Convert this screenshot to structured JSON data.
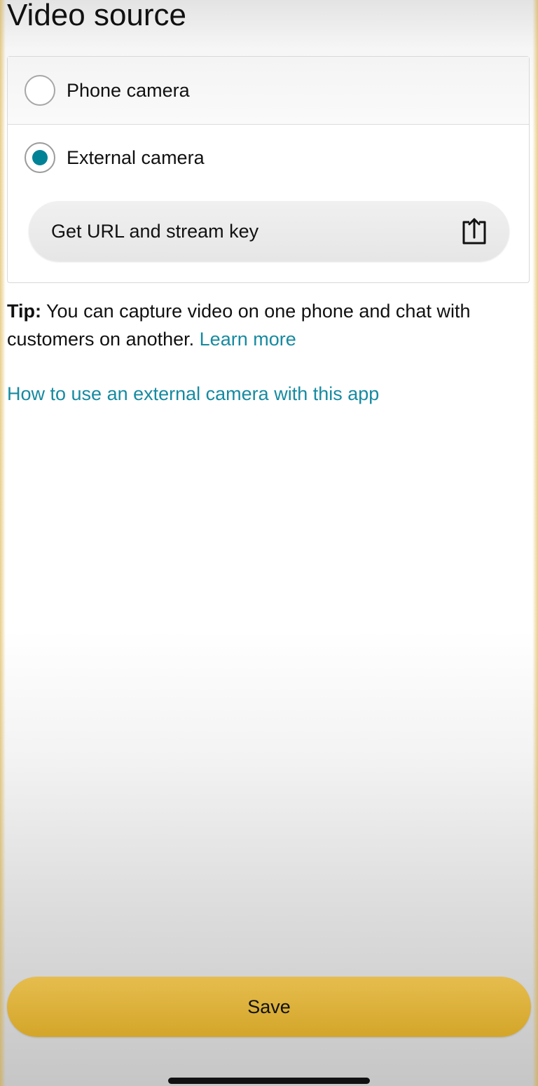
{
  "page": {
    "title": "Video source"
  },
  "video_source": {
    "options": [
      {
        "label": "Phone camera",
        "selected": false
      },
      {
        "label": "External camera",
        "selected": true
      }
    ],
    "stream_button": {
      "label": "Get URL and stream key",
      "icon": "share-icon"
    }
  },
  "tip": {
    "prefix": "Tip:",
    "text": " You can capture video on one phone and chat with customers on another. ",
    "link": "Learn more"
  },
  "help_link": "How to use an external camera with this app",
  "footer": {
    "save_label": "Save"
  },
  "colors": {
    "accent": "#008296",
    "link": "#178aa0",
    "save_button": "#dcb13a"
  }
}
